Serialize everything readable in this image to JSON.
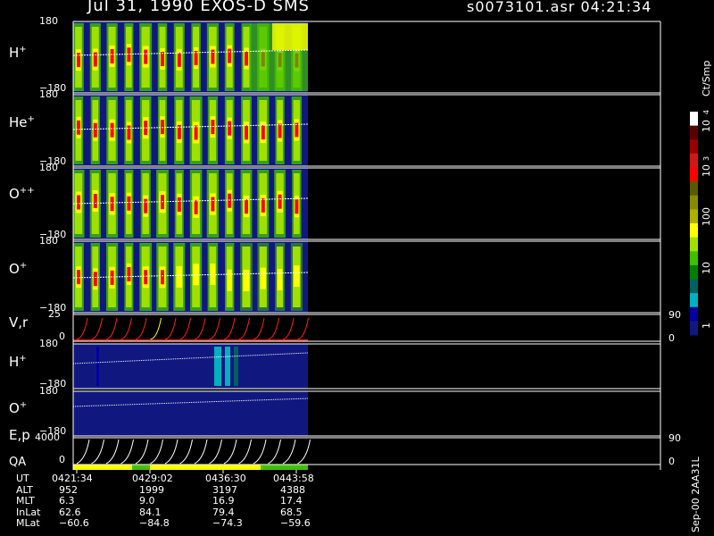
{
  "header": {
    "title": "Jul 31, 1990    EXOS-D SMS",
    "file_time": "s0073101.asr  04:21:34"
  },
  "colorbar": {
    "title": "Ct/Smp",
    "tick_labels": [
      "10",
      "4",
      "10",
      "3",
      "100",
      "10",
      "1"
    ],
    "colors": [
      "#ffffff",
      "#5a0000",
      "#9a0000",
      "#d01818",
      "#ff0000",
      "#5a5a00",
      "#8a8a00",
      "#b0b000",
      "#ffff00",
      "#a0e000",
      "#40c000",
      "#008000",
      "#006060",
      "#00b0c0",
      "#0000a0",
      "#101880"
    ]
  },
  "panels": [
    {
      "label": "H",
      "sup": "+",
      "ymax": "180",
      "ymin": "−180"
    },
    {
      "label": "He",
      "sup": "+",
      "ymax": "180",
      "ymin": "−180"
    },
    {
      "label": "O",
      "sup": "++",
      "ymax": "180",
      "ymin": "−180"
    },
    {
      "label": "O",
      "sup": "+",
      "ymax": "180",
      "ymin": "−180"
    },
    {
      "label": "V,r",
      "sup": "",
      "ymax": "25",
      "ymin": "0",
      "rmax": "90",
      "rmin": "0"
    },
    {
      "label": "H",
      "sup": "+",
      "ymax": "180",
      "ymin": "−180"
    },
    {
      "label": "O",
      "sup": "+",
      "ymax": "180",
      "ymin": "−180"
    },
    {
      "label": "E,p",
      "sup": "",
      "ymax": "4000",
      "ymin": "0",
      "rmax": "90",
      "rmin": "0"
    }
  ],
  "qa_label": "QA",
  "chart_data": {
    "type": "heatmap",
    "title": "Jul 31, 1990    EXOS-D SMS",
    "x_ticks": [
      "0421:34",
      "0429:02",
      "0436:30",
      "0443:58"
    ],
    "colorbar_unit": "Ct/Smp",
    "colorbar_range": [
      1,
      10000
    ],
    "colorbar_scale": "log"
  },
  "footer": {
    "rows": [
      {
        "label": "UT",
        "values": [
          "0421:34",
          "0429:02",
          "0436:30",
          "0443:58"
        ]
      },
      {
        "label": "ALT",
        "values": [
          "952",
          "1999",
          "3197",
          "4388"
        ]
      },
      {
        "label": "MLT",
        "values": [
          "6.3",
          "9.0",
          "16.9",
          "17.4"
        ]
      },
      {
        "label": "InLat",
        "values": [
          "62.6",
          "84.1",
          "79.4",
          "68.5"
        ]
      },
      {
        "label": "MLat",
        "values": [
          "−60.6",
          "−84.8",
          "−74.3",
          "−59.6"
        ]
      }
    ]
  },
  "credit": "Sep-00  2AA31L"
}
